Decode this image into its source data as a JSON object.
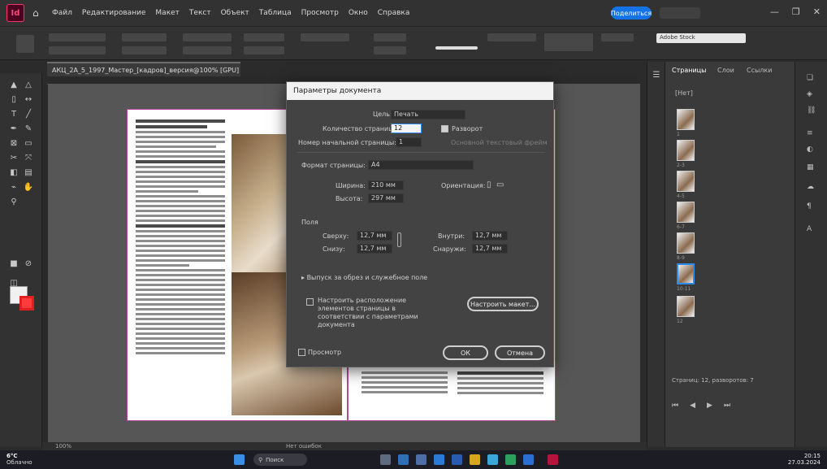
{
  "app": {
    "logo": "Id",
    "menu": [
      "Файл",
      "Редактирование",
      "Макет",
      "Текст",
      "Объект",
      "Таблица",
      "Просмотр",
      "Окно",
      "Справка"
    ],
    "share_label": "Поделиться",
    "search_stock": "Adobe Stock"
  },
  "document_tab": {
    "title": "АКЦ_2А_5_1997_Мастер_[кадров]_версия@100% [GPU]"
  },
  "dialog": {
    "title": "Параметры документа",
    "purpose_label": "Цель:",
    "purpose_value": "Печать",
    "num_pages_label": "Количество страниц:",
    "num_pages_value": "12",
    "facing_pages_label": "Разворот",
    "start_page_label": "Номер начальной страницы:",
    "start_page_value": "1",
    "primary_frame_label": "Основной текстовый фрейм",
    "page_size_label": "Формат страницы:",
    "page_size_value": "A4",
    "width_label": "Ширина:",
    "width_value": "210 мм",
    "height_label": "Высота:",
    "height_value": "297 мм",
    "orientation_label": "Ориентация:",
    "bleed_section_label": "Поля",
    "top_label": "Сверху:",
    "top_value": "12,7 мм",
    "bottom_label": "Снизу:",
    "bottom_value": "12,7 мм",
    "inside_label": "Внутри:",
    "inside_value": "12,7 мм",
    "outside_label": "Снаружи:",
    "outside_value": "12,7 мм",
    "bleed_slug_label": "Выпуск за обрез и служебное поле",
    "adjust_layout_label": "Настроить расположение элементов страницы в соответствии с параметрами документа",
    "adjust_layout_button": "Настроить макет...",
    "preview_label": "Просмотр",
    "ok_label": "ОК",
    "cancel_label": "Отмена"
  },
  "pages_panel": {
    "tabs": [
      "Страницы",
      "Слои",
      "Ссылки"
    ],
    "master_label": "[Нет]",
    "page_labels": [
      "1",
      "2-3",
      "4-5",
      "6-7",
      "8-9",
      "10-11",
      "12"
    ],
    "summary": "Страниц: 12, разворотов: 7"
  },
  "status": {
    "zoom": "100%",
    "errors": "Нет ошибок"
  },
  "taskbar": {
    "temp": "6°C",
    "weather": "Облачно",
    "search": "Поиск",
    "time": "20:15",
    "date": "27.03.2024"
  }
}
